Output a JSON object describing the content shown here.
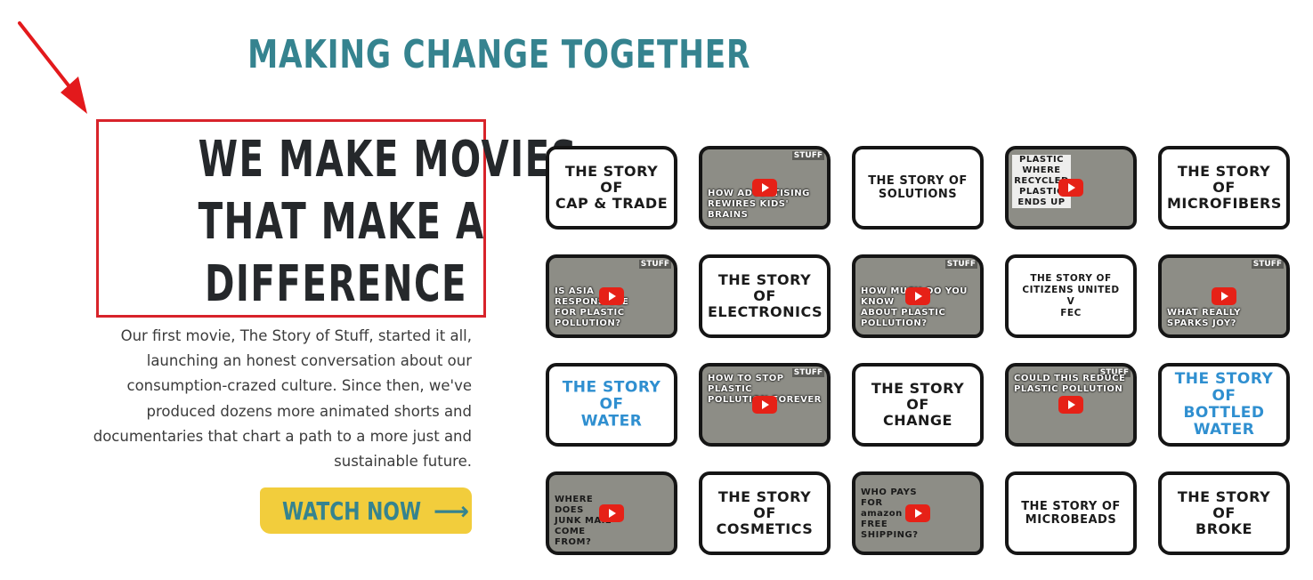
{
  "section": {
    "title": "MAKING CHANGE TOGETHER"
  },
  "headline": {
    "lines": [
      "WE MAKE MOVIES",
      "THAT MAKE A",
      "DIFFERENCE"
    ]
  },
  "intro": {
    "text": "Our first movie, The Story of Stuff, started it all, launching an honest conversation about our consumption-crazed culture. Since then, we've produced dozens more animated shorts and documentaries that chart a path to a more just and sustainable future."
  },
  "cta": {
    "label": "WATCH NOW",
    "arrow": "⟶"
  },
  "colors": {
    "accent_teal": "#35838f",
    "button_yellow": "#f2cd3c",
    "highlight_red": "#d8232a",
    "arrow_red": "#e3191c"
  },
  "videos": [
    {
      "title": "THE STORY OF\nCAP & TRADE"
    },
    {
      "title": "HOW ADVERTISING\nREWIRES KIDS' BRAINS"
    },
    {
      "title": "THE STORY OF\nSOLUTIONS"
    },
    {
      "title": "PLASTIC\nWHERE\nRECYCLED\nPLASTIC\nENDS UP"
    },
    {
      "title": "THE STORY OF\nMICROFIBERS"
    },
    {
      "title": "IS ASIA RESPONSIBLE\nFOR PLASTIC POLLUTION?"
    },
    {
      "title": "THE STORY OF\nELECTRONICS"
    },
    {
      "title": "HOW MUCH DO YOU KNOW\nABOUT PLASTIC POLLUTION?"
    },
    {
      "title": "THE STORY OF\nCITIZENS UNITED\nV\nFEC"
    },
    {
      "title": "WHAT REALLY\nSPARKS JOY?"
    },
    {
      "title": "THE STORY OF\nWATER"
    },
    {
      "title": "HOW TO STOP PLASTIC\nPOLLUTION FOREVER"
    },
    {
      "title": "THE STORY OF\nCHANGE"
    },
    {
      "title": "COULD THIS REDUCE\nPLASTIC POLLUTION"
    },
    {
      "title": "THE STORY OF\nBOTTLED\nWATER"
    },
    {
      "title": "WHERE DOES\nJUNK MAIL\nCOME FROM?"
    },
    {
      "title": "THE STORY OF\nCOSMETICS"
    },
    {
      "title": "WHO PAYS FOR\namazon\nFREE SHIPPING?"
    },
    {
      "title": "THE STORY OF\nMICROBEADS"
    },
    {
      "title": "THE STORY OF\nBROKE"
    }
  ]
}
